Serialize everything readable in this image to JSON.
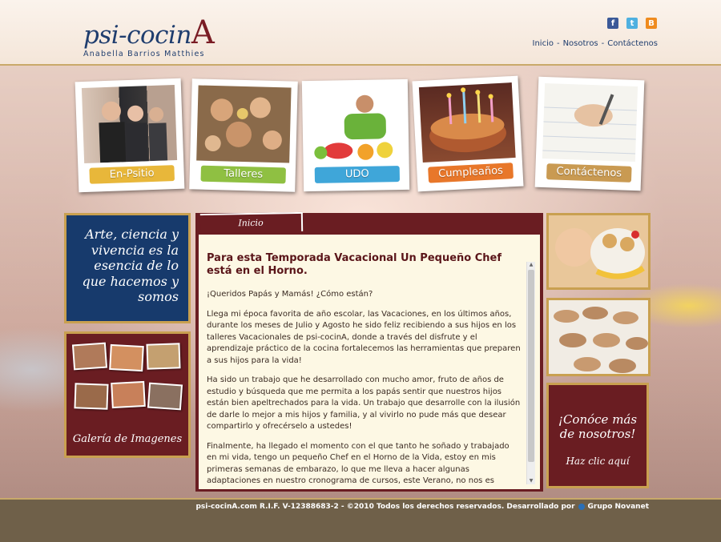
{
  "header": {
    "logo_main": "psi-cocin",
    "logo_big": "A",
    "logo_sub": "Anabella Barrios Matthies",
    "social": [
      {
        "icon": "facebook-icon",
        "glyph": "f"
      },
      {
        "icon": "twitter-icon",
        "glyph": "t"
      },
      {
        "icon": "blogger-icon",
        "glyph": "B"
      }
    ],
    "nav": [
      "Inicio",
      "Nosotros",
      "Contáctenos"
    ],
    "nav_sep": "-"
  },
  "gallery_tiles": [
    {
      "label": "En-Psitio",
      "color": "#e8b73a"
    },
    {
      "label": "Talleres",
      "color": "#8fc042"
    },
    {
      "label": "UDO",
      "color": "#3fa6d9"
    },
    {
      "label": "Cumpleaños",
      "color": "#e8772a"
    },
    {
      "label": "Contáctenos",
      "color": "#c99a52"
    }
  ],
  "quote": "Arte, ciencia y vivencia es la esencia de lo que hacemos y somos",
  "gallery_title": "Galería de Imagenes",
  "main": {
    "tab": "Inicio",
    "title": "Para esta Temporada Vacacional Un Pequeño Chef está en el Horno.",
    "paragraphs": [
      "¡Queridos Papás y Mamás! ¿Cómo están?",
      "Llega mi época favorita de año escolar, las Vacaciones, en los últimos años, durante los meses de Julio y Agosto he sido feliz recibiendo a sus hijos en los talleres Vacacionales de psi-cocinA, donde a través del disfrute y el aprendizaje práctico de la cocina fortalecemos las herramientas que preparen a sus hijos para la vida!",
      "Ha sido un trabajo que he desarrollado con mucho amor, fruto de años de estudio y búsqueda que me permita a los papás sentir que nuestros hijos están bien apeltrechados para la vida. Un trabajo que desarrolle con la ilusión de darle lo mejor a mis hijos y familia, y al vivirlo no pude más que desear compartirlo y ofrecérselo a ustedes!",
      "Finalmente, ha llegado el momento con el que tanto he soñado y trabajado en mi vida, tengo un pequeño Chef en el Horno de la Vida, estoy en mis primeras semanas de embarazo, lo que me lleva a hacer algunas adaptaciones en nuestro cronograma de cursos, este Verano, no nos es posible ofrecer los talleres en el formato semanal que les hemos ofrecido en los últimos 5 años. Haremos algo distinto, algunas clases"
    ]
  },
  "promo": {
    "line1": "¡Conóce más de nosotros!",
    "line2": "Haz clic aquí"
  },
  "footer": {
    "text": "psi-cocinA.com R.I.F. V-12388683-2 - ©2010 Todos los derechos reservados. Desarrollado por",
    "company": "Grupo Novanet"
  },
  "colors": {
    "navy": "#173a6c",
    "maroon": "#6a1d22",
    "gold": "#c9a050"
  }
}
